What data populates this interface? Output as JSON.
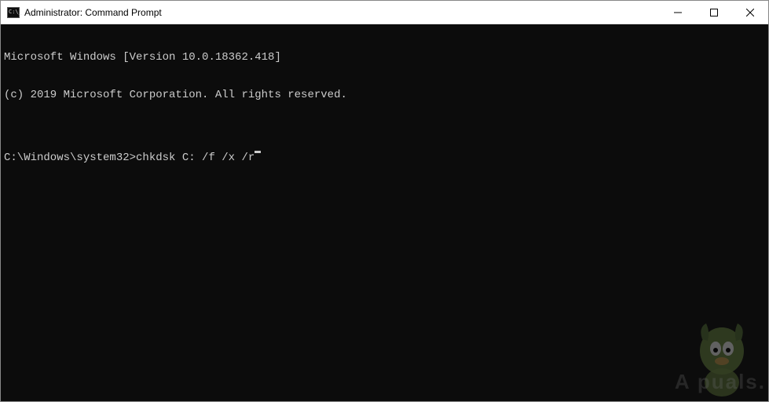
{
  "window": {
    "title": "Administrator: Command Prompt"
  },
  "terminal": {
    "line1": "Microsoft Windows [Version 10.0.18362.418]",
    "line2": "(c) 2019 Microsoft Corporation. All rights reserved.",
    "blank": "",
    "prompt": "C:\\Windows\\system32>",
    "command": "chkdsk C: /f /x /r"
  },
  "watermark": {
    "text": "A   puals."
  }
}
